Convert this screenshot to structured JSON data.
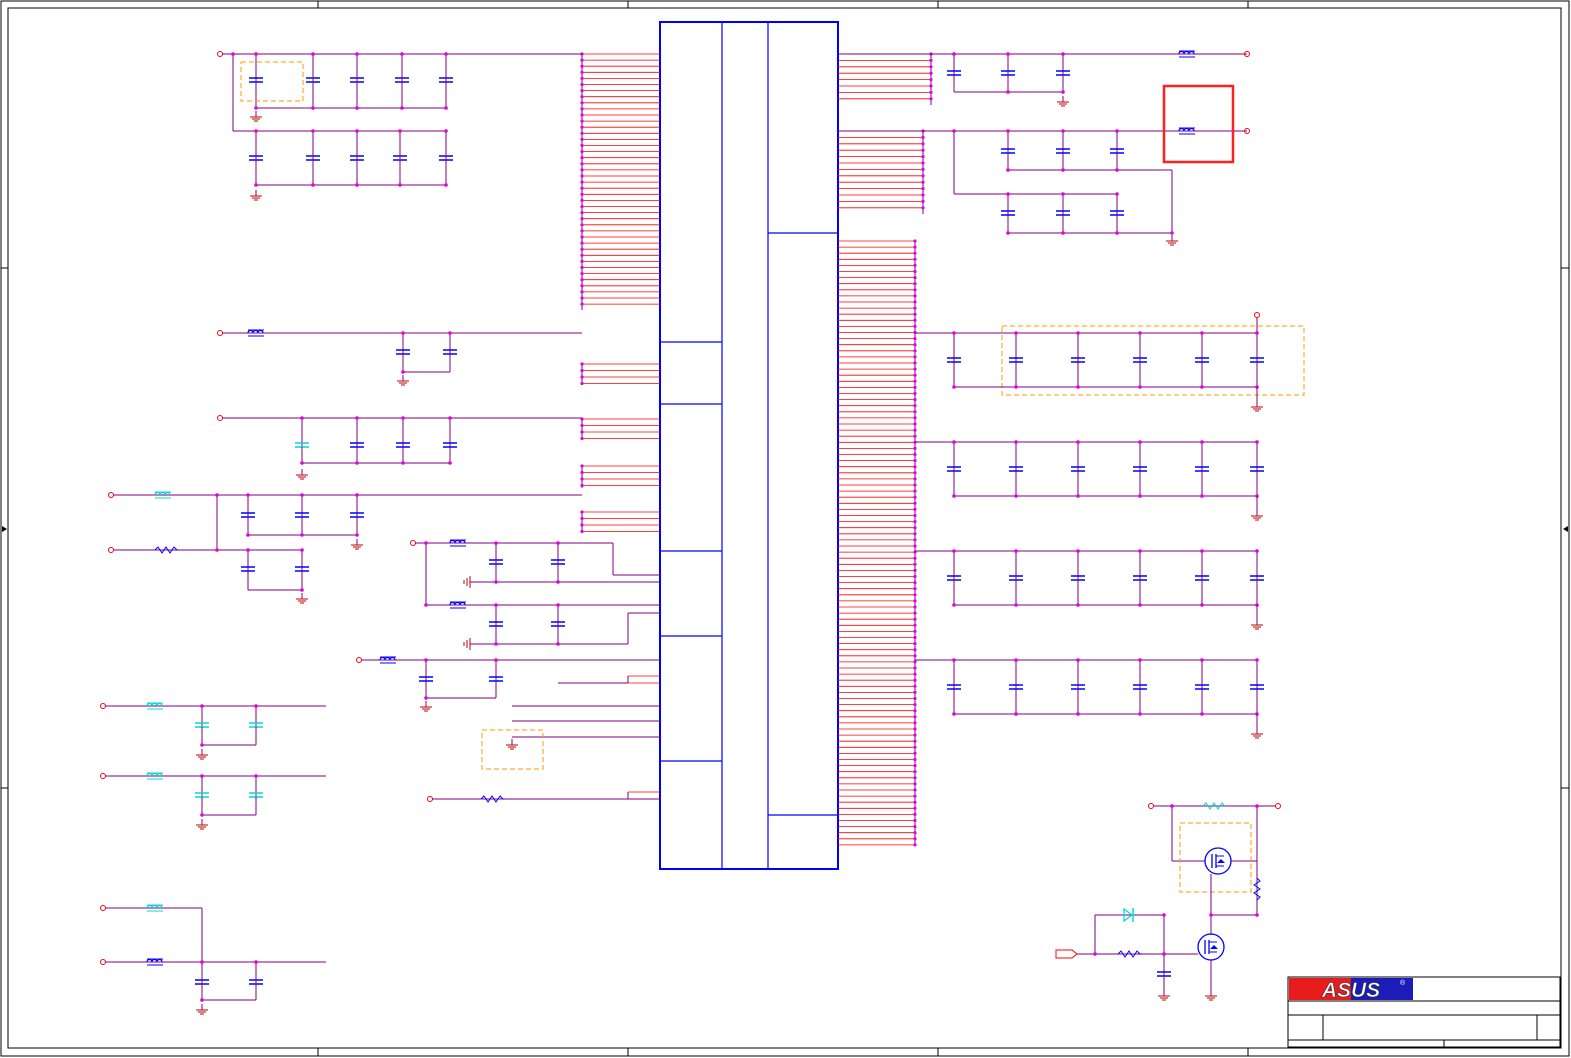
{
  "title_block": {
    "brand": "ASUS",
    "registered_mark": "®",
    "brand_colors": [
      "#e81c1c",
      "#1c1cb8"
    ]
  },
  "colors": {
    "wire": "#800080",
    "pin": "#ff0000",
    "part": "#0000ff",
    "junction": "#e000e0",
    "ground": "#c00000",
    "dnp_box": "#ff9900",
    "highlight_box": "#ff0000",
    "aux_part": "#00e0e0",
    "frame": "#000000"
  },
  "symbol_types": [
    "capacitor",
    "resistor",
    "ferrite-bead",
    "ground",
    "mosfet",
    "diode",
    "off-page-connector",
    "ic-body"
  ]
}
